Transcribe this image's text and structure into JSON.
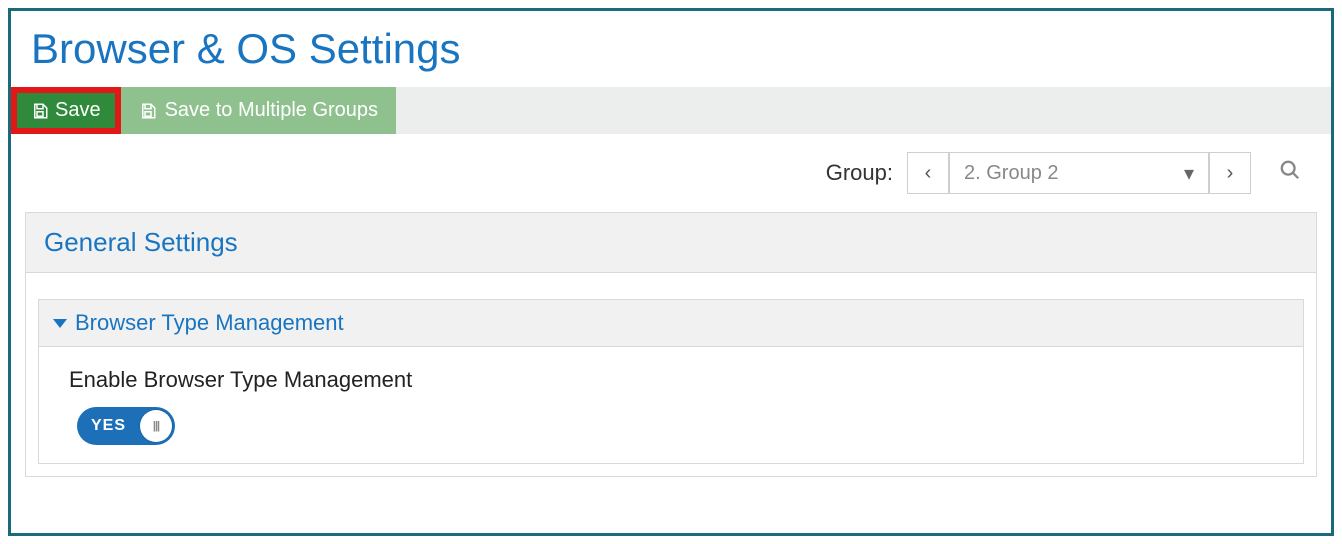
{
  "page": {
    "title": "Browser & OS Settings"
  },
  "toolbar": {
    "save_label": "Save",
    "save_multi_label": "Save to Multiple Groups"
  },
  "group_nav": {
    "label": "Group:",
    "selected": "2. Group 2"
  },
  "panel": {
    "general_header": "General Settings",
    "browser_type_header": "Browser Type Management",
    "enable_label": "Enable Browser Type Management",
    "toggle_state": "YES"
  },
  "colors": {
    "accent": "#1a75c1",
    "save_green": "#2f8a3b",
    "highlight_red": "#e21818",
    "toggle_blue": "#1d6fb8",
    "frame": "#1a6a7a"
  }
}
